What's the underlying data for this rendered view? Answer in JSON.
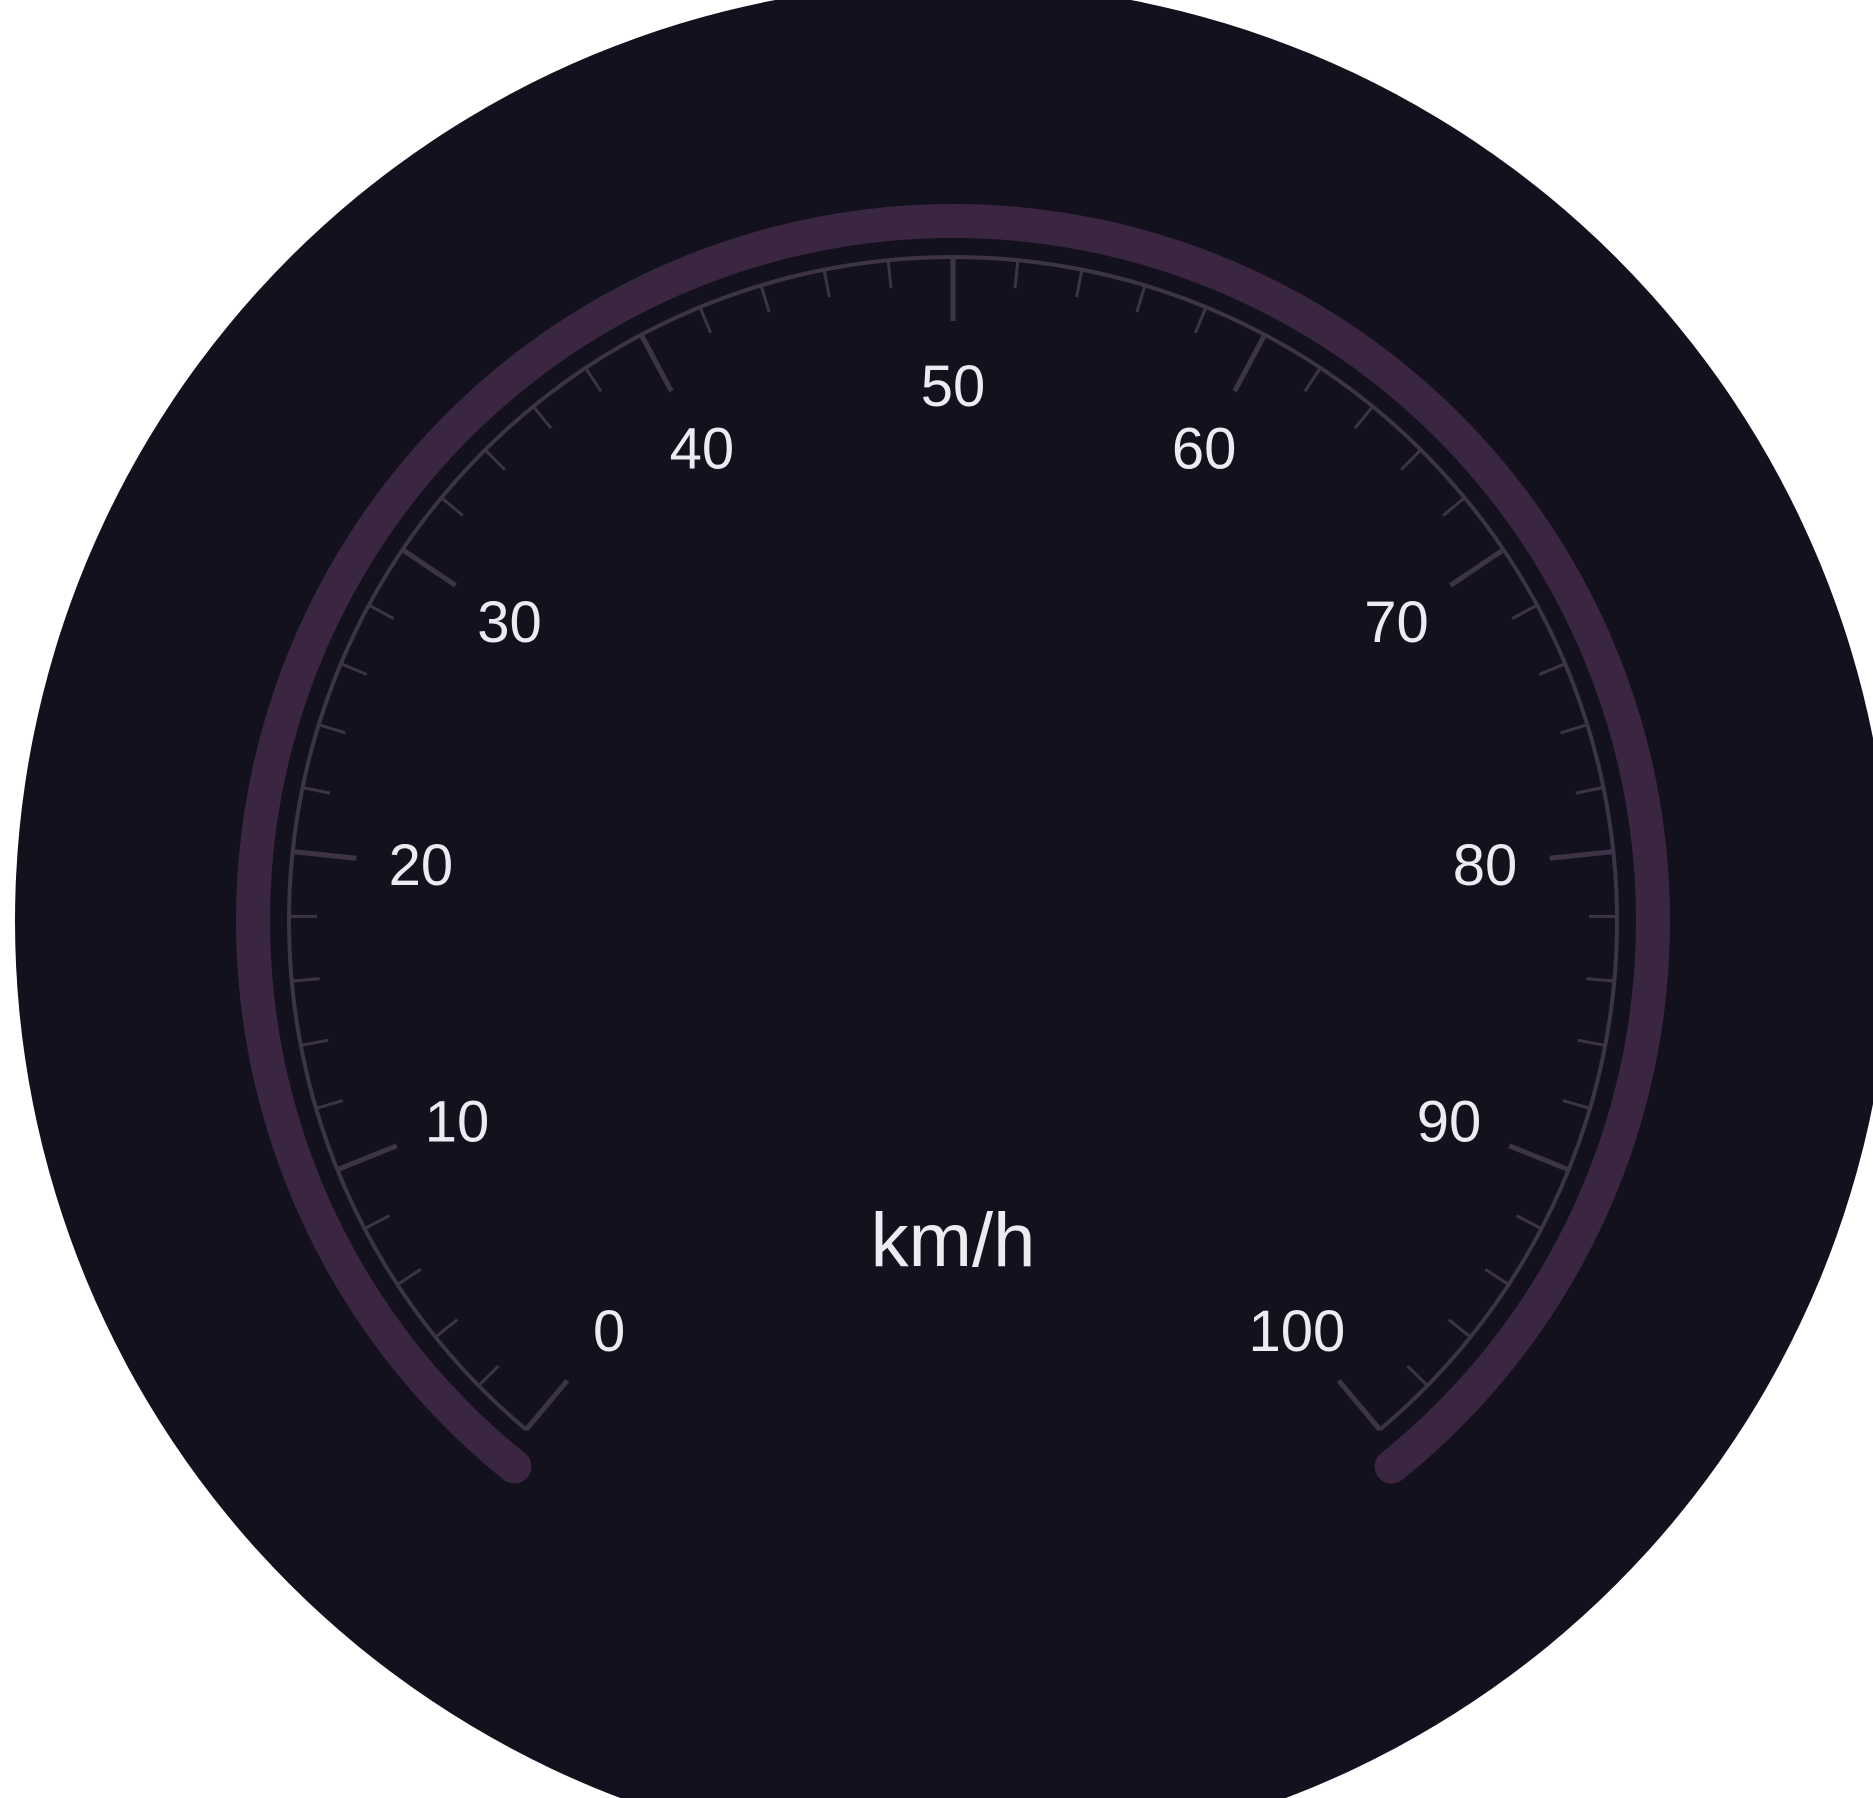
{
  "gauge": {
    "unit": "km/h",
    "min": 0,
    "max": 100,
    "major_step": 10,
    "minor_per_major": 4,
    "scale_labels": [
      "0",
      "10",
      "20",
      "30",
      "40",
      "50",
      "60",
      "70",
      "80",
      "90",
      "100"
    ],
    "sweep_degrees": 280
  },
  "colors": {
    "face": "#13111e",
    "track": "#3a2640",
    "track_edge": "#5a2d52",
    "ticks": "#3d3347",
    "labels": "#ecebf2"
  }
}
